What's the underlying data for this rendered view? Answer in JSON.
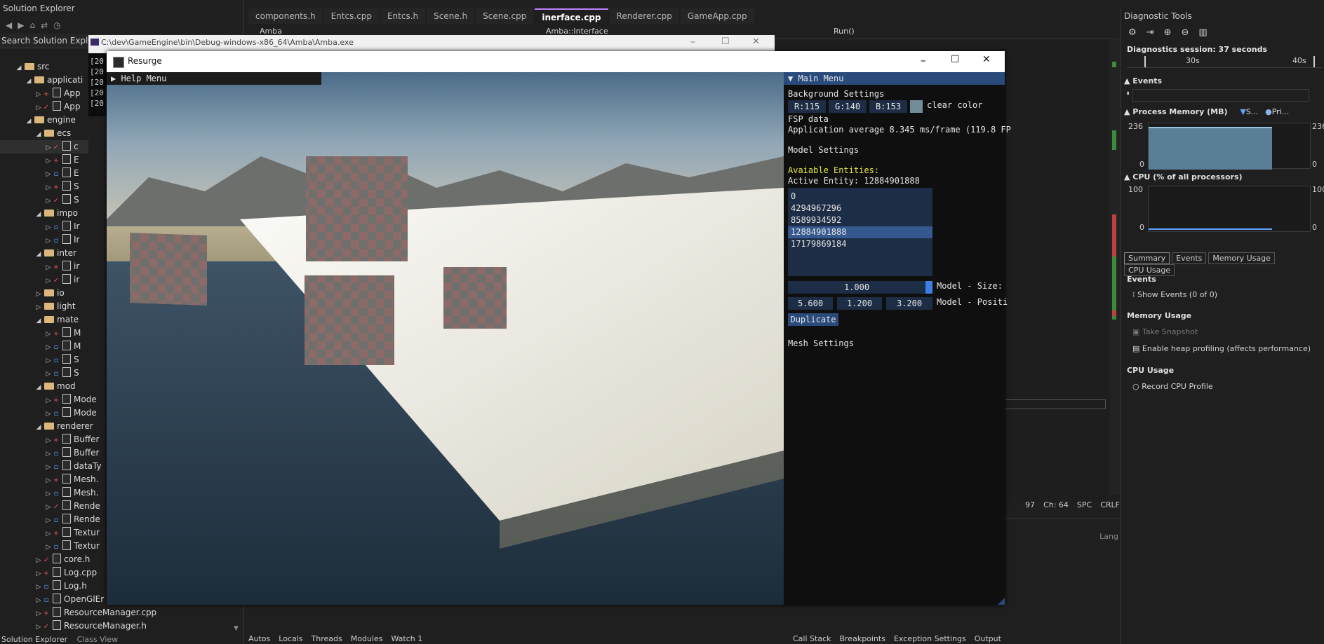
{
  "solution_explorer": {
    "title": "Solution Explorer",
    "search_placeholder": "Search Solution Explorer",
    "console_lines": [
      "[20",
      "[20",
      "[20",
      "[20",
      "[20"
    ],
    "tree": [
      {
        "label": "src",
        "kind": "folder",
        "expanded": true
      },
      {
        "label": "applicati",
        "kind": "folder",
        "expanded": true
      },
      {
        "label": "App",
        "kind": "file",
        "mark": "+"
      },
      {
        "label": "App",
        "kind": "file",
        "mark": "check"
      },
      {
        "label": "engine",
        "kind": "folder",
        "expanded": true
      },
      {
        "label": "ecs",
        "kind": "folder",
        "expanded": true
      },
      {
        "label": "c",
        "kind": "file",
        "mark": "check"
      },
      {
        "label": "E",
        "kind": "file",
        "mark": "+"
      },
      {
        "label": "E",
        "kind": "file",
        "mark": "lock"
      },
      {
        "label": "S",
        "kind": "file",
        "mark": "+"
      },
      {
        "label": "S",
        "kind": "file",
        "mark": "check"
      },
      {
        "label": "impo",
        "kind": "folder",
        "expanded": true
      },
      {
        "label": "Ir",
        "kind": "file",
        "mark": "lock"
      },
      {
        "label": "Ir",
        "kind": "file",
        "mark": "lock"
      },
      {
        "label": "inter",
        "kind": "folder",
        "expanded": true
      },
      {
        "label": "ir",
        "kind": "file",
        "mark": "+"
      },
      {
        "label": "ir",
        "kind": "file",
        "mark": "check"
      },
      {
        "label": "io",
        "kind": "folder",
        "expanded": false
      },
      {
        "label": "light",
        "kind": "folder",
        "expanded": false
      },
      {
        "label": "mate",
        "kind": "folder",
        "expanded": true
      },
      {
        "label": "M",
        "kind": "file",
        "mark": "+"
      },
      {
        "label": "M",
        "kind": "file",
        "mark": "lock"
      },
      {
        "label": "S",
        "kind": "file",
        "mark": "lock"
      },
      {
        "label": "S",
        "kind": "file",
        "mark": "lock"
      },
      {
        "label": "mod",
        "kind": "folder",
        "expanded": true
      },
      {
        "label": "Mode",
        "kind": "file",
        "mark": "+"
      },
      {
        "label": "Mode",
        "kind": "file",
        "mark": "lock"
      },
      {
        "label": "renderer",
        "kind": "folder",
        "expanded": true
      },
      {
        "label": "Buffer",
        "kind": "file",
        "mark": "+"
      },
      {
        "label": "Buffer",
        "kind": "file",
        "mark": "lock"
      },
      {
        "label": "dataTy",
        "kind": "file",
        "mark": "lock"
      },
      {
        "label": "Mesh.",
        "kind": "file",
        "mark": "+"
      },
      {
        "label": "Mesh.",
        "kind": "file",
        "mark": "lock"
      },
      {
        "label": "Rende",
        "kind": "file",
        "mark": "check"
      },
      {
        "label": "Rende",
        "kind": "file",
        "mark": "lock"
      },
      {
        "label": "Textur",
        "kind": "file",
        "mark": "+"
      },
      {
        "label": "Textur",
        "kind": "file",
        "mark": "lock"
      },
      {
        "label": "core.h",
        "kind": "file",
        "mark": "check"
      },
      {
        "label": "Log.cpp",
        "kind": "file",
        "mark": "+"
      },
      {
        "label": "Log.h",
        "kind": "file",
        "mark": "lock"
      },
      {
        "label": "OpenGlEr",
        "kind": "file",
        "mark": "lock"
      },
      {
        "label": "ResourceManager.cpp",
        "kind": "file",
        "mark": "+"
      },
      {
        "label": "ResourceManager.h",
        "kind": "file",
        "mark": "check"
      }
    ],
    "bottom_tabs": [
      "Solution Explorer",
      "Class View"
    ]
  },
  "editor": {
    "tabs": [
      {
        "label": "components.h",
        "active": false
      },
      {
        "label": "Entcs.cpp",
        "active": false
      },
      {
        "label": "Entcs.h",
        "active": false
      },
      {
        "label": "Scene.h",
        "active": false
      },
      {
        "label": "Scene.cpp",
        "active": false
      },
      {
        "label": "inerface.cpp",
        "active": true
      },
      {
        "label": "Renderer.cpp",
        "active": false
      },
      {
        "label": "GameApp.cpp",
        "active": false
      }
    ],
    "nav_project": "Amba",
    "nav_scope": "Amba::Interface",
    "nav_member": "Run()",
    "status": {
      "line": "97",
      "col": "Ch: 64",
      "spc": "SPC",
      "eol": "CRLF"
    },
    "bottom_tabs_left": [
      "Autos",
      "Locals",
      "Threads",
      "Modules",
      "Watch 1"
    ],
    "bottom_tabs_right": [
      "Call Stack",
      "Breakpoints",
      "Exception Settings",
      "Output"
    ],
    "right_hint": "Lang"
  },
  "console_window": {
    "title": "C:\\dev\\GameEngine\\bin\\Debug-windows-x86_64\\Amba\\Amba.exe"
  },
  "game_window": {
    "title": "Resurge",
    "help_menu": "Help Menu",
    "main_menu": {
      "header": "Main Menu",
      "background_settings": "Background Settings",
      "r": "R:115",
      "g": "G:140",
      "b": "B:153",
      "clear_color_label": "clear color",
      "clear_color": "#738c99",
      "fps_title": "FSP data",
      "fps_text": "Application average 8.345 ms/frame (119.8 FP",
      "model_settings": "Model Settings",
      "available_entities": "Avaiable Entities:",
      "active_entity_label": "Active Entity:  12884901888",
      "entities": [
        "0",
        "4294967296",
        "8589934592",
        "12884901888",
        "17179869184"
      ],
      "selected_entity": "12884901888",
      "size_value": "1.000",
      "size_label": "Model - Size:",
      "pos_x": "5.600",
      "pos_y": "1.200",
      "pos_z": "3.200",
      "pos_label": "Model - Positi",
      "duplicate": "Duplicate",
      "mesh_settings": "Mesh Settings"
    }
  },
  "diagnostics": {
    "title": "Diagnostic Tools",
    "session": "Diagnostics session: 37 seconds",
    "ticks": [
      "30s",
      "40s"
    ],
    "events": "Events",
    "process_memory": "Process Memory (MB)",
    "legend_s": "S...",
    "legend_pri": "Pri...",
    "mem_max": "236",
    "mem_min": "0",
    "mem_max_r": "236",
    "mem_min_r": "0",
    "cpu": "CPU (% of all processors)",
    "cpu_max": "100",
    "cpu_min": "0",
    "cpu_max_r": "100",
    "cpu_min_r": "0",
    "tabs": [
      "Summary",
      "Events",
      "Memory Usage",
      "CPU Usage"
    ],
    "events_hdr": "Events",
    "show_events": "Show Events (0 of 0)",
    "memory_hdr": "Memory Usage",
    "take_snapshot": "Take Snapshot",
    "heap_profiling": "Enable heap profiling (affects performance)",
    "cpu_hdr": "CPU Usage",
    "record_cpu": "Record CPU Profile"
  }
}
